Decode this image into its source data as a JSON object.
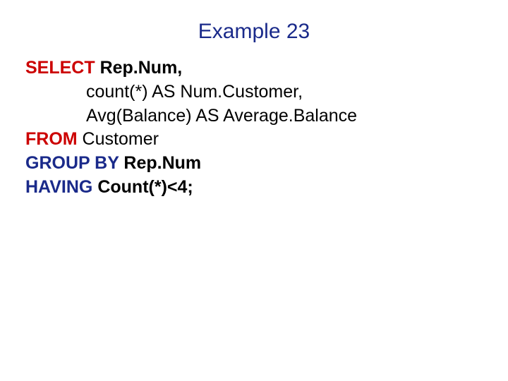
{
  "title": "Example 23",
  "code": {
    "l1_kw": "SELECT",
    "l1_rest": " Rep.Num,",
    "l2": "count(*) AS Num.Customer,",
    "l3": "Avg(Balance) AS Average.Balance",
    "l4_kw": "FROM",
    "l4_rest": " Customer",
    "l5_kw": "GROUP BY",
    "l5_rest": " Rep.Num",
    "l6_kw": "HAVING",
    "l6_rest": " Count(*)<4;"
  }
}
